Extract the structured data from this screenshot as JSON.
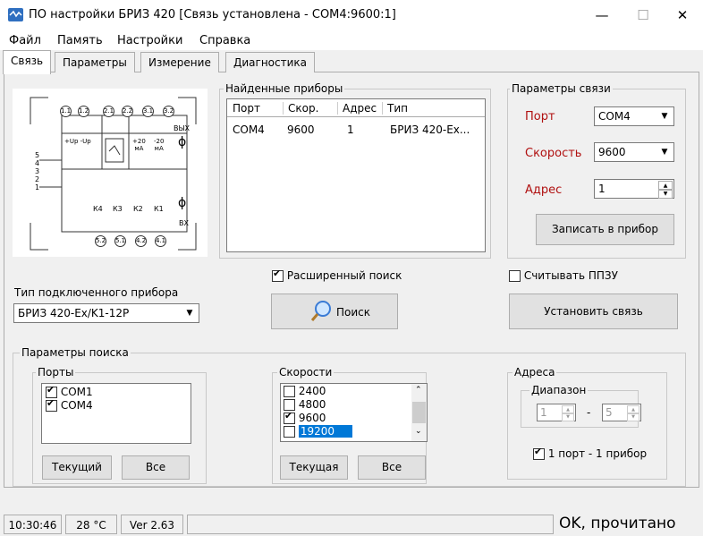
{
  "window": {
    "title": "ПО настройки БРИЗ 420 [Связь установлена - COM4:9600:1]",
    "minimize": "—",
    "maximize": "☐",
    "close": "✕"
  },
  "menu": [
    "Файл",
    "Память",
    "Настройки",
    "Справка"
  ],
  "tabs": [
    "Связь",
    "Параметры",
    "Измерение",
    "Диагностика"
  ],
  "diagram": {
    "top_terminals": [
      "1.1",
      "1.2",
      "2.1",
      "2.2",
      "3.1",
      "3.2"
    ],
    "bottom_terminals": [
      "5.2",
      "5.1",
      "4.2",
      "4.1"
    ],
    "side_numbers": [
      "5",
      "4",
      "3",
      "2",
      "1"
    ],
    "upup": "+Up -Up",
    "ma1": "+20",
    "ma1u": "мА",
    "ma2": "-20",
    "ma2u": "мА",
    "vyh": "ВЫХ",
    "vx": "ВХ",
    "k_labels": [
      "К4",
      "К3",
      "К2",
      "К1"
    ]
  },
  "found": {
    "label": "Найденные приборы",
    "headers": [
      "Порт",
      "Скор.",
      "Адрес",
      "Тип"
    ],
    "rows": [
      [
        "COM4",
        "9600",
        "1",
        "БРИЗ 420-Ex..."
      ]
    ]
  },
  "conn": {
    "label": "Параметры связи",
    "port_label": "Порт",
    "port_value": "COM4",
    "speed_label": "Скорость",
    "speed_value": "9600",
    "addr_label": "Адрес",
    "addr_value": "1",
    "write_button": "Записать в прибор"
  },
  "extended_search": {
    "label": "Расширенный поиск",
    "checked": true
  },
  "read_ppzu": {
    "label": "Считывать ППЗУ",
    "checked": false
  },
  "device_type": {
    "label": "Тип подключенного прибора",
    "value": "БРИЗ 420-Ex/K1-12P"
  },
  "search_button": "Поиск",
  "connect_button": "Установить связь",
  "search_params": {
    "label": "Параметры поиска",
    "ports": {
      "label": "Порты",
      "items": [
        {
          "name": "COM1",
          "checked": true
        },
        {
          "name": "COM4",
          "checked": true
        }
      ],
      "current_button": "Текущий",
      "all_button": "Все"
    },
    "speeds": {
      "label": "Скорости",
      "items": [
        {
          "name": "2400",
          "checked": false
        },
        {
          "name": "4800",
          "checked": false
        },
        {
          "name": "9600",
          "checked": true
        },
        {
          "name": "19200",
          "checked": false,
          "selected": true
        }
      ],
      "current_button": "Текущая",
      "all_button": "Все"
    },
    "addresses": {
      "label": "Адреса",
      "range_label": "Диапазон",
      "from": "1",
      "dash": "-",
      "to": "5",
      "one_port_one_device": {
        "label": "1 порт - 1 прибор",
        "checked": true
      }
    }
  },
  "status": {
    "time": "10:30:46",
    "temp": "28 °C",
    "version": "Ver 2.63",
    "message": "OK, прочитано"
  },
  "colors": {
    "accent_red": "#b01010",
    "selection_blue": "#0078d7"
  }
}
